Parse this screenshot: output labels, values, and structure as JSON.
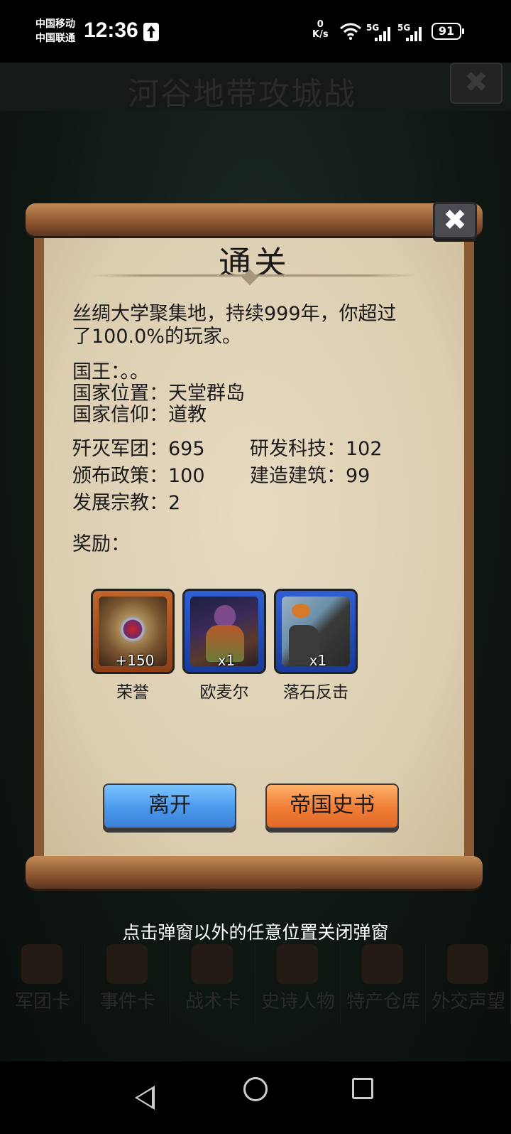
{
  "status_bar": {
    "carrier_1": "中国移动",
    "carrier_2": "中国联通",
    "time": "12:36",
    "net_speed_value": "0",
    "net_speed_unit": "K/s",
    "signal_1_label": "5G",
    "signal_2_label": "5G",
    "battery": "91"
  },
  "background": {
    "header_title": "河谷地带攻城战",
    "close_label": "✖",
    "tabs": [
      {
        "label": "军团卡"
      },
      {
        "label": "事件卡"
      },
      {
        "label": "战术卡"
      },
      {
        "label": "史诗人物"
      },
      {
        "label": "特产仓库"
      },
      {
        "label": "外交声望"
      }
    ]
  },
  "dialog": {
    "title": "通关",
    "close_label": "✖",
    "summary_line_1": "丝绸大学聚集地，持续999年，你超过",
    "summary_line_2": "了100.0%的玩家。",
    "king": "国王：。。",
    "location": "国家位置：天堂群岛",
    "religion": "国家信仰：道教",
    "stats": {
      "annihilated": "歼灭军团：695",
      "research": "研发科技：102",
      "policies": "颁布政策：100",
      "buildings": "建造建筑：99",
      "religions": "发展宗教：2"
    },
    "rewards_label": "奖励：",
    "rewards": [
      {
        "name": "荣誉",
        "qty": "+150",
        "icon": "honor-medal-icon"
      },
      {
        "name": "欧麦尔",
        "qty": "x1",
        "icon": "hero-portrait-icon"
      },
      {
        "name": "落石反击",
        "qty": "x1",
        "icon": "rockfall-card-icon"
      }
    ],
    "leave_button": "离开",
    "history_button": "帝国史书"
  },
  "hint": "点击弹窗以外的任意位置关闭弹窗",
  "colors": {
    "parchment": "#e2d5bb",
    "leave_button": "#4a98ec",
    "history_button": "#f07c36"
  }
}
